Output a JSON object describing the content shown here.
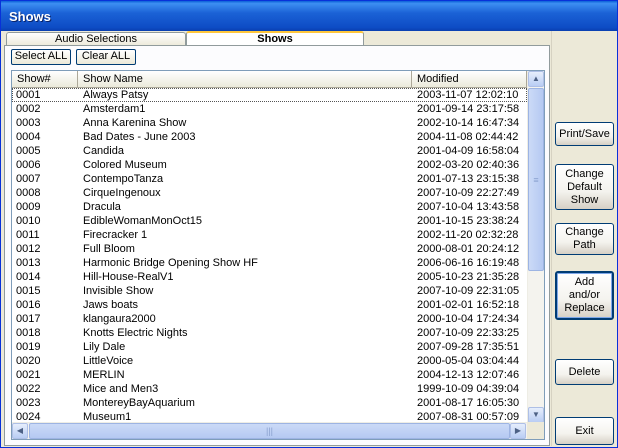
{
  "window": {
    "title": "Shows"
  },
  "tabs": [
    {
      "label": "Audio Selections"
    },
    {
      "label": "Shows"
    }
  ],
  "toolbar": {
    "select_all": "Select ALL",
    "clear_all": "Clear ALL"
  },
  "list": {
    "columns": [
      "Show#",
      "Show Name",
      "Modified"
    ],
    "rows": [
      [
        "0001",
        "Always Patsy",
        "2003-11-07 12:02:10"
      ],
      [
        "0002",
        "Amsterdam1",
        "2001-09-14 23:17:58"
      ],
      [
        "0003",
        "Anna Karenina Show",
        "2002-10-14 16:47:34"
      ],
      [
        "0004",
        "Bad Dates - June 2003",
        "2004-11-08 02:44:42"
      ],
      [
        "0005",
        "Candida",
        "2001-04-09 16:58:04"
      ],
      [
        "0006",
        "Colored Museum",
        "2002-03-20 02:40:36"
      ],
      [
        "0007",
        "ContempoTanza",
        "2001-07-13 23:15:38"
      ],
      [
        "0008",
        "CirqueIngenoux",
        "2007-10-09 22:27:49"
      ],
      [
        "0009",
        "Dracula",
        "2007-10-04 13:43:58"
      ],
      [
        "0010",
        "EdibleWomanMonOct15",
        "2001-10-15 23:38:24"
      ],
      [
        "0011",
        "Firecracker 1",
        "2002-11-20 02:32:28"
      ],
      [
        "0012",
        "Full Bloom",
        "2000-08-01 20:24:12"
      ],
      [
        "0013",
        "Harmonic Bridge Opening Show HF",
        "2006-06-16 16:19:48"
      ],
      [
        "0014",
        "Hill-House-RealV1",
        "2005-10-23 21:35:28"
      ],
      [
        "0015",
        "Invisible Show",
        "2007-10-09 22:31:05"
      ],
      [
        "0016",
        "Jaws boats",
        "2001-02-01 16:52:18"
      ],
      [
        "0017",
        "klangaura2000",
        "2000-10-04 17:24:34"
      ],
      [
        "0018",
        "Knotts Electric Nights",
        "2007-10-09 22:33:25"
      ],
      [
        "0019",
        "Lily Dale",
        "2007-09-28 17:35:51"
      ],
      [
        "0020",
        "LittleVoice",
        "2000-05-04 03:04:44"
      ],
      [
        "0021",
        "MERLIN",
        "2004-12-13 12:07:46"
      ],
      [
        "0022",
        "Mice and Men3",
        "1999-10-09 04:39:04"
      ],
      [
        "0023",
        "MontereyBayAquarium",
        "2001-08-17 16:05:30"
      ],
      [
        "0024",
        "Museum1",
        "2007-08-31 00:57:09"
      ]
    ]
  },
  "side_buttons": {
    "print_save": "Print/Save",
    "change_default_show": [
      "Change",
      "Default",
      "Show"
    ],
    "change_path": [
      "Change",
      "Path"
    ],
    "add_replace": [
      "Add",
      "and/or",
      "Replace"
    ],
    "delete": "Delete",
    "exit": "Exit"
  }
}
